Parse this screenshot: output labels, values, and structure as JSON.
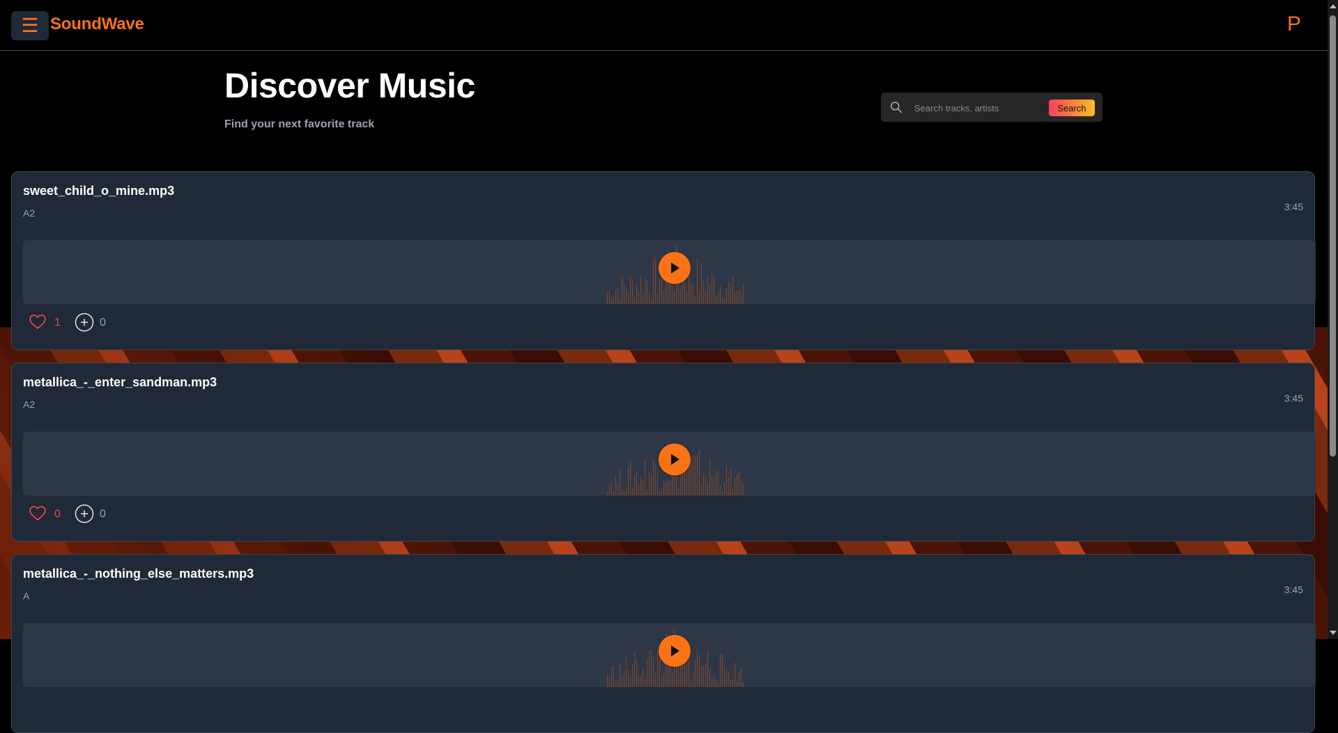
{
  "header": {
    "brand": "SoundWave",
    "menu_icon": "☰",
    "profile_initial": "P"
  },
  "hero": {
    "title": "Discover Music",
    "subtitle": "Find your next favorite track"
  },
  "search": {
    "placeholder": "Search tracks, artists",
    "button_label": "Search"
  },
  "colors": {
    "accent": "#f97316",
    "like": "#ef4444",
    "card": "#1f2937"
  },
  "tracks": [
    {
      "title": "sweet_child_o_mine.mp3",
      "artist": "A2",
      "duration": "3:45",
      "likes": "1",
      "adds": "0"
    },
    {
      "title": "metallica_-_enter_sandman.mp3",
      "artist": "A2",
      "duration": "3:45",
      "likes": "0",
      "adds": "0"
    },
    {
      "title": "metallica_-_nothing_else_matters.mp3",
      "artist": "A",
      "duration": "3:45",
      "likes": "",
      "adds": ""
    }
  ]
}
